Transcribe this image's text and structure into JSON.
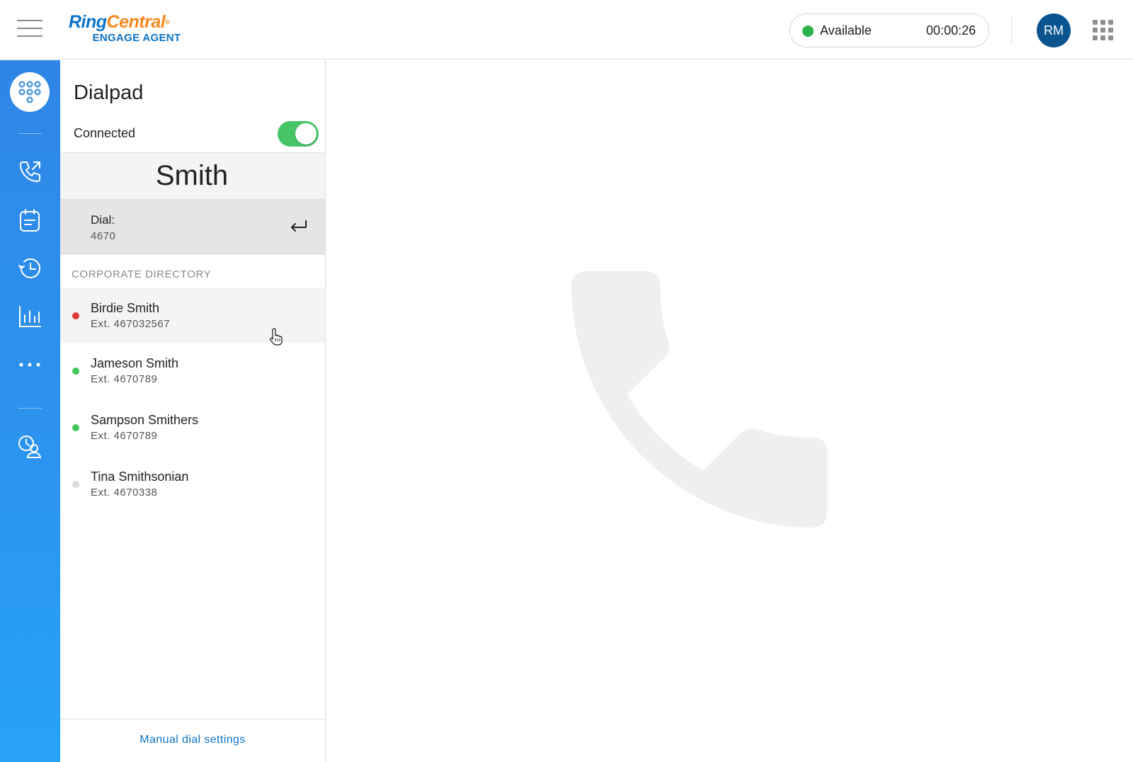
{
  "header": {
    "logo": {
      "brand_ring": "Ring",
      "brand_central": "Central",
      "trademark": "®",
      "product": "ENGAGE AGENT"
    },
    "status": {
      "label": "Available",
      "timer": "00:00:26",
      "color": "#2bb24c"
    },
    "avatar_initials": "RM"
  },
  "rail": {
    "items": [
      {
        "name": "dialpad",
        "icon": "dialpad-icon",
        "active": true
      },
      {
        "name": "calls",
        "icon": "phone-outgoing-icon"
      },
      {
        "name": "schedule",
        "icon": "calendar-icon"
      },
      {
        "name": "history",
        "icon": "history-icon"
      },
      {
        "name": "analytics",
        "icon": "bar-chart-icon"
      },
      {
        "name": "more",
        "icon": "more-horizontal-icon"
      },
      {
        "name": "agent-status",
        "icon": "user-clock-icon"
      }
    ]
  },
  "dialpad": {
    "title": "Dialpad",
    "connected_label": "Connected",
    "connected": true,
    "search_value": "Smith",
    "dial": {
      "label": "Dial:",
      "number": "4670"
    },
    "directory_header": "CORPORATE DIRECTORY",
    "contacts": [
      {
        "name": "Birdie Smith",
        "ext": "Ext. 467032567",
        "presence": "#e53935"
      },
      {
        "name": "Jameson Smith",
        "ext": "Ext. 4670789",
        "presence": "#43c75d"
      },
      {
        "name": "Sampson Smithers",
        "ext": "Ext. 4670789",
        "presence": "#43c75d"
      },
      {
        "name": "Tina Smithsonian",
        "ext": "Ext. 4670338",
        "presence": "#dcdcdc"
      }
    ],
    "footer_link": "Manual dial settings"
  },
  "colors": {
    "accent": "#0b73c9",
    "rail_top": "#2e86e6",
    "rail_bottom": "#26a3f6",
    "toggle_on": "#46c566"
  }
}
